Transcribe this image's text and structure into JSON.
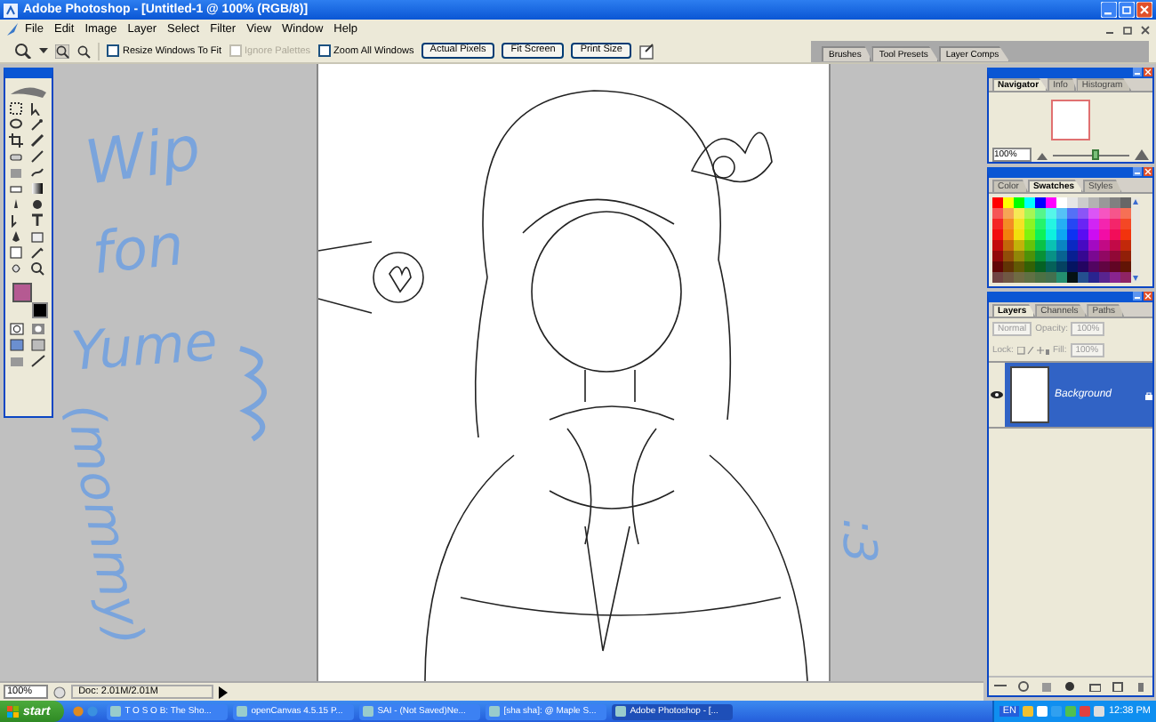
{
  "window": {
    "title": "Adobe Photoshop - [Untitled-1 @ 100% (RGB/8)]"
  },
  "menu": [
    "File",
    "Edit",
    "Image",
    "Layer",
    "Select",
    "Filter",
    "View",
    "Window",
    "Help"
  ],
  "options_bar": {
    "checkboxes": [
      {
        "label": "Resize Windows To Fit",
        "checked": false,
        "disabled": false
      },
      {
        "label": "Ignore Palettes",
        "checked": false,
        "disabled": true
      },
      {
        "label": "Zoom All Windows",
        "checked": false,
        "disabled": false
      }
    ],
    "buttons": [
      "Actual Pixels",
      "Fit Screen",
      "Print Size"
    ]
  },
  "palette_well": {
    "tabs": [
      "Brushes",
      "Tool Presets",
      "Layer Comps"
    ]
  },
  "toolbox": {
    "colors": [
      {
        "kind": "foreground",
        "color": "#b55a92"
      },
      {
        "kind": "background",
        "color": "#000000"
      }
    ]
  },
  "annotations": [
    {
      "text": "Wip",
      "kind": "wip"
    },
    {
      "text": "fon",
      "kind": "fon"
    },
    {
      "text": "Yume",
      "kind": "yume"
    },
    {
      "text": "(mommy)",
      "kind": "mommy"
    },
    {
      "text": ":3",
      "kind": "smile"
    }
  ],
  "navigator": {
    "tabs": [
      {
        "label": "Navigator",
        "selected": true
      },
      {
        "label": "Info",
        "selected": false
      },
      {
        "label": "Histogram",
        "selected": false
      }
    ],
    "zoom": "100%",
    "level": 0.55
  },
  "swatches": {
    "tabs": [
      {
        "label": "Color",
        "selected": false
      },
      {
        "label": "Swatches",
        "selected": true
      },
      {
        "label": "Styles",
        "selected": false
      }
    ]
  },
  "layers": {
    "tabs": [
      {
        "label": "Layers",
        "selected": true
      },
      {
        "label": "Channels",
        "selected": false
      },
      {
        "label": "Paths",
        "selected": false
      }
    ],
    "blend_mode": "Normal",
    "opacity_label": "Opacity:",
    "opacity": "100%",
    "lock_label": "Lock:",
    "fill_label": "Fill:",
    "fill": "100%",
    "items": [
      {
        "name": "Background",
        "selected": true,
        "visible": true
      }
    ]
  },
  "status_bar": {
    "zoom": "100%",
    "doc": "Doc: 2.01M/2.01M"
  },
  "taskbar": {
    "start": "start",
    "tasks": [
      {
        "label": "T O S O B: The Sho...",
        "selected": false
      },
      {
        "label": "openCanvas 4.5.15 P...",
        "selected": false
      },
      {
        "label": "SAI - (Not Saved)Ne...",
        "selected": false
      },
      {
        "label": "[sha sha]: @ Maple S...",
        "selected": false
      },
      {
        "label": "Adobe Photoshop - [...",
        "selected": true
      }
    ],
    "language": "EN",
    "clock": "12:38 PM"
  }
}
